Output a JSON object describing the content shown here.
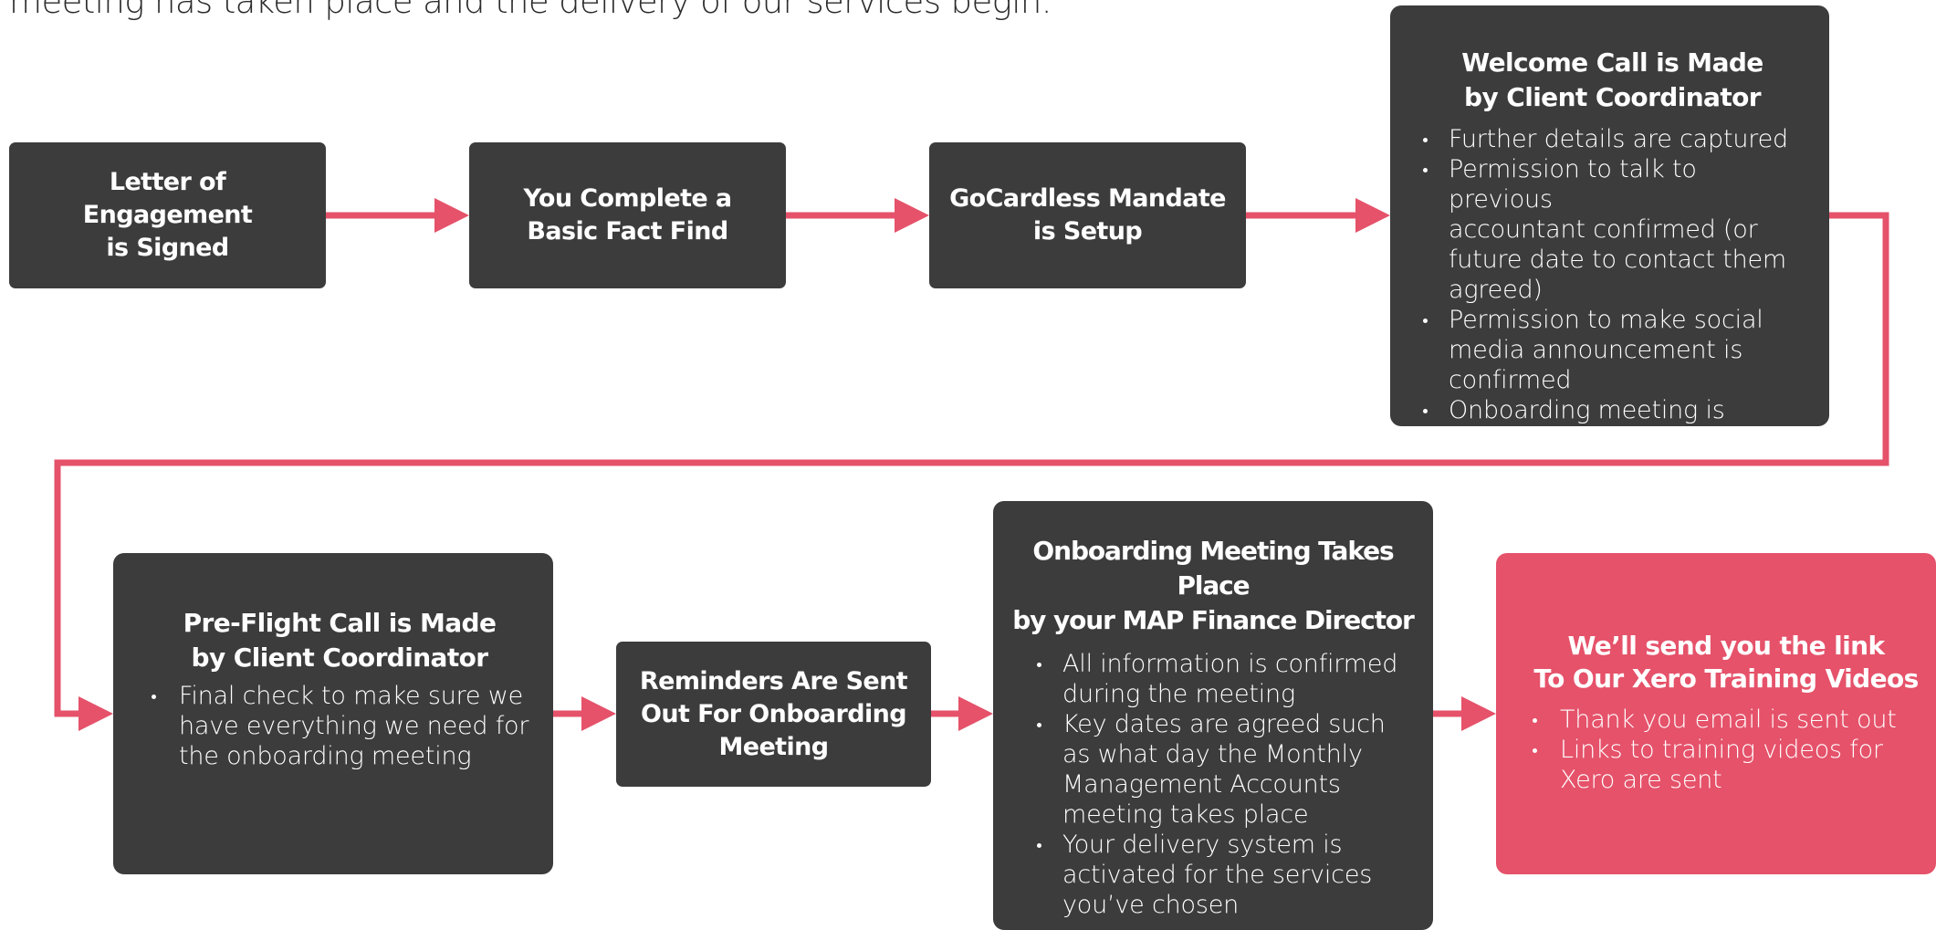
{
  "intro": {
    "line1": "meeting has taken place and the delivery of our services begin."
  },
  "colors": {
    "box": "#3c3c3c",
    "accent": "#e5526a",
    "connector": "#e5526a",
    "text": "#ffffff"
  },
  "steps": {
    "letter": {
      "title": "Letter of\nEngagement\nis Signed"
    },
    "factfind": {
      "title": "You Complete a\nBasic Fact Find"
    },
    "gocardless": {
      "title": "GoCardless Mandate\nis Setup"
    },
    "welcome": {
      "title": "Welcome Call is Made\nby Client Coordinator",
      "items": [
        "Further details are captured",
        "Permission to talk to previous\naccountant confirmed (or\nfuture date to contact them\nagreed)",
        "Permission to make social\nmedia announcement is\nconfirmed",
        "Onboarding meeting is agreed"
      ]
    },
    "preflight": {
      "title": "Pre-Flight Call is Made\nby Client Coordinator",
      "items": [
        "Final check to make sure we\nhave everything we need for\nthe onboarding meeting"
      ]
    },
    "reminders": {
      "title": "Reminders Are Sent\nOut For Onboarding\nMeeting"
    },
    "onboarding": {
      "title": "Onboarding Meeting Takes Place\nby your MAP Finance Director",
      "items": [
        "All information is confirmed\nduring the meeting",
        "Key dates are agreed such\nas what day the Monthly\nManagement Accounts\nmeeting takes place",
        "Your delivery system is\nactivated for the services\nyou’ve chosen"
      ]
    },
    "xero": {
      "title": "We’ll send you the link\nTo Our Xero Training Videos",
      "items": [
        "Thank you email is sent out",
        "Links to training videos for\nXero are sent"
      ]
    }
  }
}
